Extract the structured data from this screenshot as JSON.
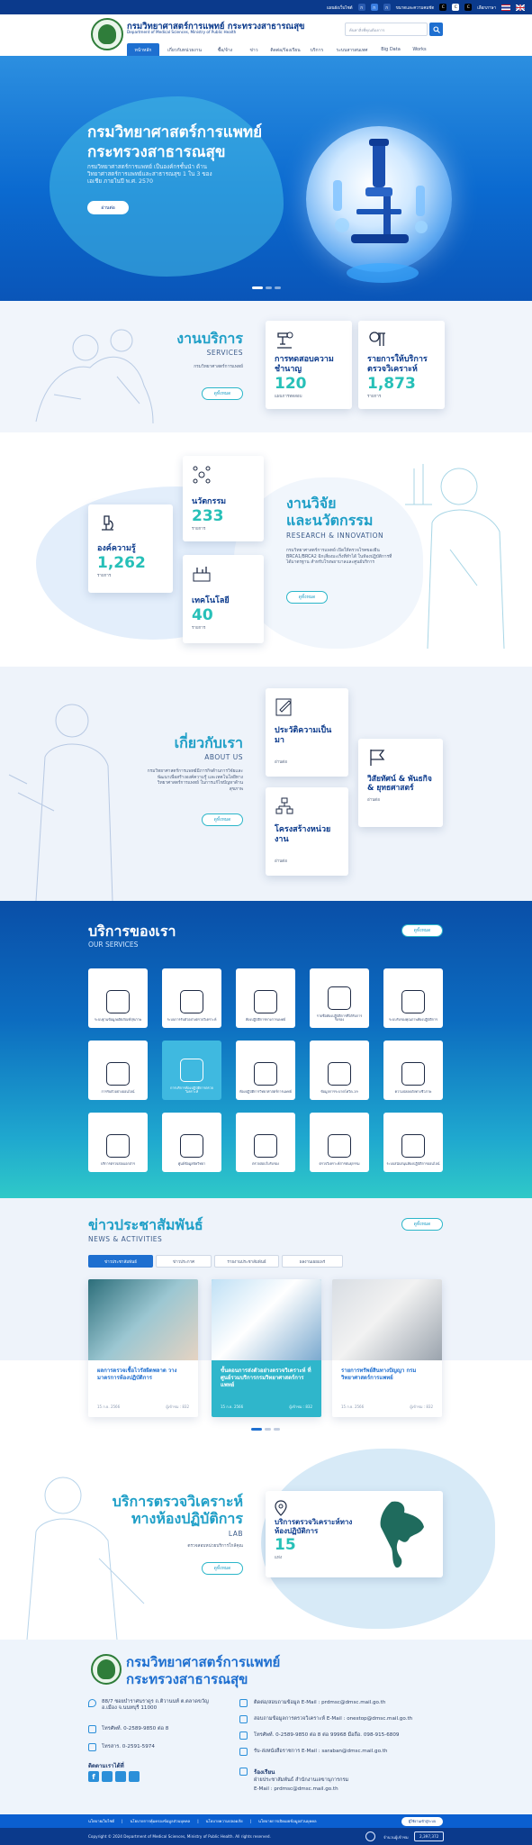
{
  "topbar": {
    "sitemap": "แผนผังเว็บไซต์",
    "font_minus": "ก",
    "font_normal": "ก",
    "font_plus": "ก",
    "contrast_label": "ขนาดและความคมชัด",
    "dark": "C",
    "light": "C",
    "en_pill": "C",
    "translate": "เลือกภาษา",
    "flag_th": "flag-th-icon",
    "flag_en": "flag-en-icon"
  },
  "header": {
    "title_th": "กรมวิทยาศาสตร์การแพทย์ กระทรวงสาธารณสุข",
    "title_en": "Department of Medical Sciences, Ministry of Public Health",
    "search_placeholder": "ค้นหาสิ่งที่คุณต้องการ"
  },
  "nav": [
    "หน้าหลัก",
    "เกี่ยวกับหน่วยงาน",
    "ซื้อ/จ้าง",
    "ข่าว",
    "ติดต่อ/ร้องเรียน",
    "บริการ",
    "ระบบสารสนเทศ",
    "Big Data",
    "Works"
  ],
  "hero": {
    "title_line1": "กรมวิทยาศาสตร์การแพทย์",
    "title_line2": "กระทรวงสาธารณสุข",
    "sub": "กรมวิทยาศาสตร์การแพทย์ เป็นองค์กรชั้นนำ ด้านวิทยาศาสตร์การแพทย์และสาธารณสุข 1 ใน 3 ของเอเชีย ภายในปี พ.ศ. 2570",
    "button": "อ่านต่อ"
  },
  "services_intro": {
    "title": "งานบริการ",
    "subtitle": "SERVICES",
    "desc": "กรมวิทยาศาสตร์การแพทย์",
    "button": "ดูทั้งหมด",
    "card1": {
      "title": "การทดสอบความชำนาญ",
      "number": "120",
      "unit": "แผนการทดสอบ"
    },
    "card2": {
      "title": "รายการให้บริการตรวจวิเคราะห์",
      "number": "1,873",
      "unit": "รายการ"
    }
  },
  "research": {
    "title_line1": "งานวิจัย",
    "title_line2": "และนวัตกรรม",
    "subtitle": "RESEARCH & INNOVATION",
    "desc": "กรมวิทยาศาสตร์การแพทย์ เปิดให้ตรวจโรคของยีน BRCA1/BRCA2 ฉีกเสี่ยงมะเร็งที่ทำได้ ในห้องปฏิบัติการที่ได้มาตรฐาน สำหรับโรงพยาบาลและศูนย์บริการ",
    "button": "ดูทั้งหมด",
    "innovation": {
      "title": "นวัตกรรม",
      "number": "233",
      "unit": "รายการ"
    },
    "knowledge": {
      "title": "องค์ความรู้",
      "number": "1,262",
      "unit": "รายการ"
    },
    "technology": {
      "title": "เทคโนโลยี",
      "number": "40",
      "unit": "รายการ"
    }
  },
  "about": {
    "title": "เกี่ยวกับเรา",
    "subtitle": "ABOUT US",
    "desc": "กรมวิทยาศาสตร์การแพทย์มีภารกิจด้านการวิจัยและพัฒนาเพื่อสร้างองค์ความรู้ และเทคโนโลยีทางวิทยาศาสตร์การแพทย์ ในการแก้ไขปัญหาด้านสุขภาพ",
    "button": "ดูทั้งหมด",
    "history": {
      "title": "ประวัติความเป็นมา",
      "link": "อ่านต่อ"
    },
    "vision": {
      "title": "วิสัยทัศน์ & พันธกิจ & ยุทธศาสตร์",
      "link": "อ่านต่อ"
    },
    "structure": {
      "title": "โครงสร้างหน่วยงาน",
      "link": "อ่านต่อ"
    }
  },
  "our_services": {
    "title": "บริการของเรา",
    "subtitle": "OUR SERVICES",
    "button": "ดูทั้งหมด",
    "items": [
      "ระบบฐานข้อมูลผลิตภัณฑ์สุขภาพ",
      "ระบบการรับตัวอย่างตรวจวิเคราะห์",
      "ห้องปฏิบัติการทางการแพทย์",
      "รายชื่อห้องปฏิบัติการที่ได้รับการรับรอง",
      "ระบบรับรองคุณภาพห้องปฏิบัติการ",
      "การรับตัวอย่างออนไลน์",
      "การบริการห้องปฏิบัติการตรวจวิเคราะห์",
      "ห้องปฏิบัติการวิทยาศาสตร์การแพทย์",
      "ข้อมูลการระบาดโควิด-19",
      "ความปลอดภัยทางชีวภาพ",
      "บริการตรวจสอบเอกสาร",
      "ศูนย์ข้อมูลพิษวิทยา",
      "ตรวจสอบใบรับรอง",
      "ตรวจวิเคราะห์สารพันธุกรรม",
      "ระบบสนับสนุนห้องปฏิบัติการออนไลน์"
    ]
  },
  "news": {
    "title": "ข่าวประชาสัมพันธ์",
    "subtitle": "NEWS & ACTIVITIES",
    "button": "ดูทั้งหมด",
    "tabs": [
      "ข่าวประชาสัมพันธ์",
      "ข่าวประกาศ",
      "รายงานประชาสัมพันธ์",
      "ผลงานเผยแพร่"
    ],
    "items": [
      {
        "title": "ผลการตรวจเชื้อไวรัสผิดพลาด วางมาตรการห้องปฏิบัติการ",
        "date": "15 ก.ย. 2566",
        "views": "ผู้เข้าชม : 832"
      },
      {
        "title": "ขั้นตอนการส่งตัวอย่างตรวจวิเคราะห์ ที่ศูนย์รวมบริการกรมวิทยาศาสตร์การแพทย์",
        "date": "15 ก.ย. 2566",
        "views": "ผู้เข้าชม : 832"
      },
      {
        "title": "รายการทรัพย์สินทางปัญญา กรมวิทยาศาสตร์การแพทย์",
        "date": "15 ก.ย. 2566",
        "views": "ผู้เข้าชม : 832"
      }
    ]
  },
  "lab": {
    "title_line1": "บริการตรวจวิเคราะห์",
    "title_line2": "ทางห้องปฏิบัติการ",
    "subtitle": "LAB",
    "desc": "ตรวจสอบหน่วยบริการใกล้คุณ",
    "button": "ดูทั้งหมด",
    "card_title": "บริการตรวจวิเคราะห์ทางห้องปฏิบัติการ",
    "card_number": "15",
    "card_unit": "แห่ง"
  },
  "footer": {
    "title_line1": "กรมวิทยาศาสตร์การแพทย์",
    "title_line2": "กระทรวงสาธารณสุข",
    "address": "88/7 ซอยบำราศนราดูร ถ.ติวานนท์ ต.ตลาดขวัญ อ.เมือง จ.นนทบุรี 11000",
    "phone": "โทรศัพท์. 0-2589-9850 ต่อ 8",
    "fax": "โทรสาร. 0-2591-5974",
    "follow": "ติดตามเราได้ที่",
    "contact1": "ติดต่อ/สอบถามข้อมูล E-Mail : prdmsc@dmsc.mail.go.th",
    "contact2": "สอบถามข้อมูลการตรวจวิเคราะห์ E-Mail : onestop@dmsc.mail.go.th",
    "contact3": "โทรศัพท์. 0-2589-9850 ต่อ 8 ต่อ 99968 มือถือ. 098-915-6809",
    "contact4": "รับ-ส่งหนังสือราชการ E-Mail : saraban@dmsc.mail.go.th",
    "complaint_title": "ร้องเรียน",
    "complaint_line1": "ฝ่ายประชาสัมพันธ์ สำนักงานเลขานุการกรม",
    "complaint_line2": "E-Mail : prdmsc@dmsc.mail.go.th"
  },
  "bottom": {
    "links": [
      "นโยบายเว็บไซต์",
      "นโยบายการคุ้มครองข้อมูลส่วนบุคคล",
      "นโยบายความปลอดภัย",
      "นโยบายการเปิดเผยข้อมูลส่วนบุคคล"
    ],
    "copyright": "Copyright © 2024 Department of Medical Sciences, Ministry of Public Health. All rights reserved.",
    "visitors_label": "จำนวนผู้เข้าชม",
    "visitors": "2,397,372",
    "badge": "ผู้ใช้งานเข้าสู่ระบบ"
  },
  "colors": {
    "primary": "#0b3a8c",
    "accent": "#1f9fc7",
    "teal": "#27c0b8",
    "blue": "#1e6fd0"
  }
}
